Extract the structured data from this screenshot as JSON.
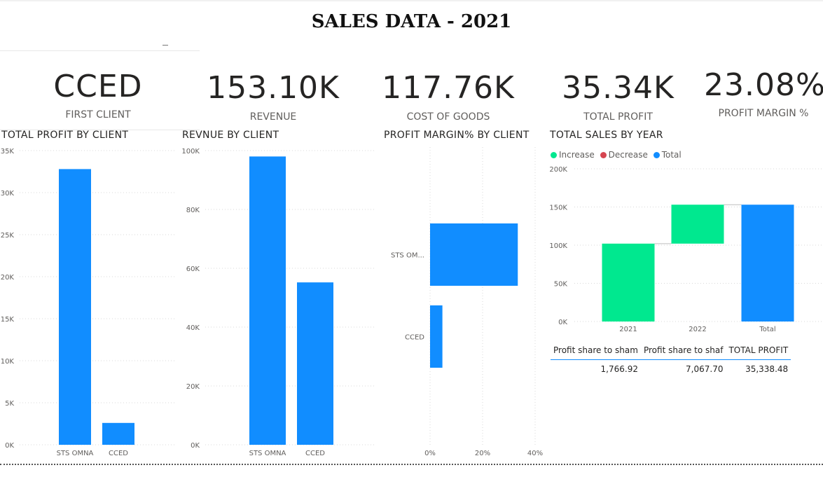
{
  "page": {
    "title": "SALES DATA - 2021"
  },
  "kpis": [
    {
      "value": "CCED",
      "label": "FIRST CLIENT"
    },
    {
      "value": "153.10K",
      "label": "REVENUE"
    },
    {
      "value": "117.76K",
      "label": "COST OF GOODS"
    },
    {
      "value": "35.34K",
      "label": "TOTAL PROFIT"
    },
    {
      "value": "23.08%",
      "label": "PROFIT MARGIN %"
    }
  ],
  "colors": {
    "bar": "#118dff",
    "increase": "#00e88f",
    "decrease": "#d64550",
    "total": "#118dff"
  },
  "chart_data": [
    {
      "type": "bar",
      "title": "TOTAL PROFIT BY CLIENT",
      "categories": [
        "STS OMNA",
        "CCED"
      ],
      "values": [
        32800,
        2600
      ],
      "ylim": [
        0,
        35000
      ],
      "yticks": [
        0,
        5000,
        10000,
        15000,
        20000,
        25000,
        30000,
        35000
      ],
      "ytick_labels": [
        "0K",
        "5K",
        "10K",
        "15K",
        "20K",
        "25K",
        "30K",
        "35K"
      ],
      "grid": true
    },
    {
      "type": "bar",
      "title": "REVNUE BY CLIENT",
      "categories": [
        "STS OMNA",
        "CCED"
      ],
      "values": [
        98000,
        55200
      ],
      "ylim": [
        0,
        100000
      ],
      "yticks": [
        0,
        20000,
        40000,
        60000,
        80000,
        100000
      ],
      "ytick_labels": [
        "0K",
        "20K",
        "40K",
        "60K",
        "80K",
        "100K"
      ],
      "grid": true
    },
    {
      "type": "bar",
      "orientation": "horizontal",
      "title": "PROFIT MARGIN% BY CLIENT",
      "categories": [
        "STS OM...",
        "CCED"
      ],
      "values": [
        33.4,
        4.7
      ],
      "xlim": [
        0,
        40
      ],
      "xticks": [
        0,
        20,
        40
      ],
      "xtick_labels": [
        "0%",
        "20%",
        "40%"
      ],
      "grid": true
    },
    {
      "type": "waterfall",
      "title": "TOTAL SALES BY YEAR",
      "legend": [
        "Increase",
        "Decrease",
        "Total"
      ],
      "legend_position": "top-left",
      "categories": [
        "2021",
        "2022",
        "Total"
      ],
      "values": [
        102000,
        51000,
        153000
      ],
      "kinds": [
        "increase",
        "increase",
        "total"
      ],
      "ylim": [
        0,
        200000
      ],
      "yticks": [
        0,
        50000,
        100000,
        150000,
        200000
      ],
      "ytick_labels": [
        "0K",
        "50K",
        "100K",
        "150K",
        "200K"
      ],
      "grid": true
    }
  ],
  "profit_table": {
    "headers": [
      "Profit share to sham",
      "Profit share to shaf",
      "TOTAL PROFIT"
    ],
    "values": [
      "1,766.92",
      "7,067.70",
      "35,338.48"
    ]
  }
}
